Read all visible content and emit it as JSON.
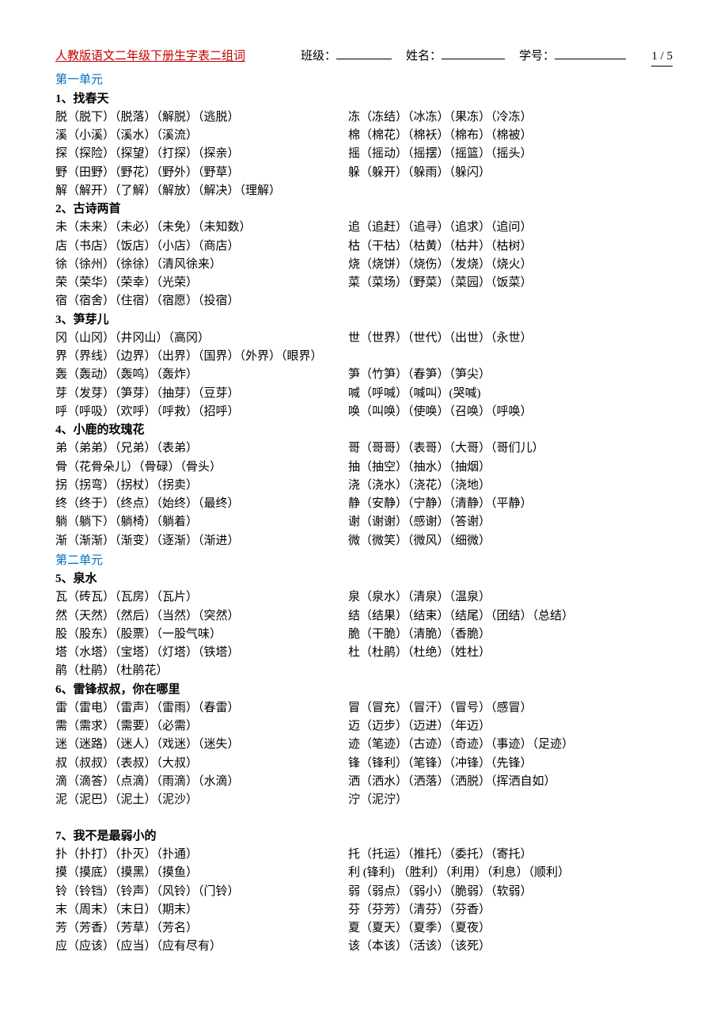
{
  "header": {
    "title": "人教版语文二年级下册生字表二组词",
    "class_label": "班级：",
    "name_label": "姓名：",
    "id_label": "学号：",
    "page_current": "1",
    "page_sep": " / ",
    "page_total": "5"
  },
  "units": [
    {
      "title": "第一单元",
      "lessons": [
        {
          "title": "1、找春天",
          "rows": [
            {
              "l": "脱（脱下）（脱落）（解脱）（逃脱）",
              "r": "冻（冻结）（冰冻）（果冻）（冷冻）"
            },
            {
              "l": "溪（小溪）（溪水）（溪流）",
              "r": "棉（棉花）（棉袄）（棉布）（棉被）"
            },
            {
              "l": "探（探险）（探望）（打探）（探亲）",
              "r": "摇（摇动）（摇摆）（摇篮）（摇头）"
            },
            {
              "l": "野（田野）（野花）（野外）（野草）",
              "r": "躲（躲开）（躲雨）（躲闪）"
            },
            {
              "l": "解（解开）（了解）（解放）（解决）（理解）",
              "r": ""
            }
          ]
        },
        {
          "title": "2、古诗两首",
          "rows": [
            {
              "l": "未（未来）（未必）（未免）（未知数）",
              "r": "追（追赶）（追寻）（追求）（追问）"
            },
            {
              "l": "店（书店）（饭店）（小店）（商店）",
              "r": "枯（干枯）（枯黄）（枯井）（枯树）"
            },
            {
              "l": "徐（徐州）（徐徐）（清风徐来）",
              "r": "烧（烧饼）（烧伤）（发烧）（烧火）"
            },
            {
              "l": "荣（荣华）（荣幸）（光荣）",
              "r": "菜（菜场）（野菜）（菜园）（饭菜）"
            },
            {
              "l": "宿（宿舍）（住宿）（宿愿）（投宿）",
              "r": ""
            }
          ]
        },
        {
          "title": "3、笋芽儿",
          "rows": [
            {
              "l": "冈（山冈）（井冈山）（高冈）",
              "r": "世（世界）（世代）（出世）（永世）"
            },
            {
              "l": "界（界线）（边界）（出界）（国界）（外界）（眼界）",
              "r": ""
            },
            {
              "l": "轰（轰动）（轰鸣）（轰炸）",
              "r": "笋（竹笋）（春笋）（笋尖）"
            },
            {
              "l": "芽（发芽）（笋芽）（抽芽）（豆芽）",
              "r": "喊（呼喊）（喊叫）(哭喊)"
            },
            {
              "l": "呼（呼吸）（欢呼）（呼救）（招呼）",
              "r": "唤（叫唤）（使唤）（召唤）（呼唤）"
            }
          ]
        },
        {
          "title": "4、小鹿的玫瑰花",
          "rows": [
            {
              "l": "弟（弟弟）（兄弟）（表弟）",
              "r": "哥（哥哥）（表哥）（大哥）（哥们儿）"
            },
            {
              "l": "骨（花骨朵儿）（骨碌）（骨头）",
              "r": "抽（抽空）（抽水）（抽烟）"
            },
            {
              "l": "拐（拐弯）（拐杖）（拐卖）",
              "r": "浇（浇水）（浇花）（浇地）"
            },
            {
              "l": "终（终于）（终点）（始终）（最终）",
              "r": "静（安静）（宁静）（清静）（平静）"
            },
            {
              "l": "躺（躺下）（躺椅）（躺着）",
              "r": "谢（谢谢）（感谢）（答谢）"
            },
            {
              "l": "渐（渐渐）（渐变）（逐渐）（渐进）",
              "r": "微（微笑）（微风）（细微）"
            }
          ]
        }
      ]
    },
    {
      "title": "第二单元",
      "lessons": [
        {
          "title": "5、泉水",
          "rows": [
            {
              "l": "瓦（砖瓦）（瓦房）（瓦片）",
              "r": "泉（泉水）（清泉）（温泉）"
            },
            {
              "l": "然（天然）（然后）（当然）（突然）",
              "r": "结（结果）（结束）（结尾）（团结）（总结）"
            },
            {
              "l": "股（股东）（股票）（一股气味）",
              "r": "脆（干脆）（清脆）（香脆）"
            },
            {
              "l": "塔（水塔）（宝塔）（灯塔）（铁塔）",
              "r": "杜（杜鹃）（杜绝）（姓杜）"
            },
            {
              "l": "鹃（杜鹃）（杜鹃花）",
              "r": ""
            }
          ]
        },
        {
          "title": "6、雷锋叔叔，你在哪里",
          "rows": [
            {
              "l": "雷（雷电）（雷声）（雷雨）（春雷）",
              "r": "冒（冒充）（冒汗）（冒号）（感冒）"
            },
            {
              "l": "需（需求）（需要）（必需）",
              "r": "迈（迈步）（迈进）（年迈）"
            },
            {
              "l": "迷（迷路）（迷人）（戏迷）（迷失）",
              "r": "迹（笔迹）（古迹）（奇迹）（事迹）（足迹）"
            },
            {
              "l": "叔（叔叔）（表叔）（大叔）",
              "r": "锋（锋利）（笔锋）（冲锋）（先锋）"
            },
            {
              "l": "滴（滴答）（点滴）（雨滴）（水滴）",
              "r": "洒（洒水）（洒落）（洒脱）（挥洒自如）"
            },
            {
              "l": "泥（泥巴）（泥土）（泥沙）",
              "r": "泞（泥泞）"
            }
          ]
        },
        {
          "title": "7、我不是最弱小的",
          "gap_before": true,
          "rows": [
            {
              "l": "扑（扑打）（扑灭）（扑通）",
              "r": "托（托运）（推托）（委托）（寄托）"
            },
            {
              "l": "摸（摸底）（摸黑）（摸鱼）",
              "r": "利 (锋利)  （胜利）（利用）（利息）（顺利）"
            },
            {
              "l": "铃（铃铛）（铃声）（风铃）（门铃）",
              "r": "弱（弱点）（弱小）（脆弱）（软弱）"
            },
            {
              "l": "末（周末）（末日）（期末）",
              "r": "芬（芬芳）（清芬）（芬香）"
            },
            {
              "l": "芳（芳香）（芳草）（芳名）",
              "r": "夏（夏天）（夏季）（夏夜）"
            },
            {
              "l": "应（应该）（应当）（应有尽有）",
              "r": "该（本该）（活该）（该死）"
            }
          ]
        }
      ]
    }
  ]
}
